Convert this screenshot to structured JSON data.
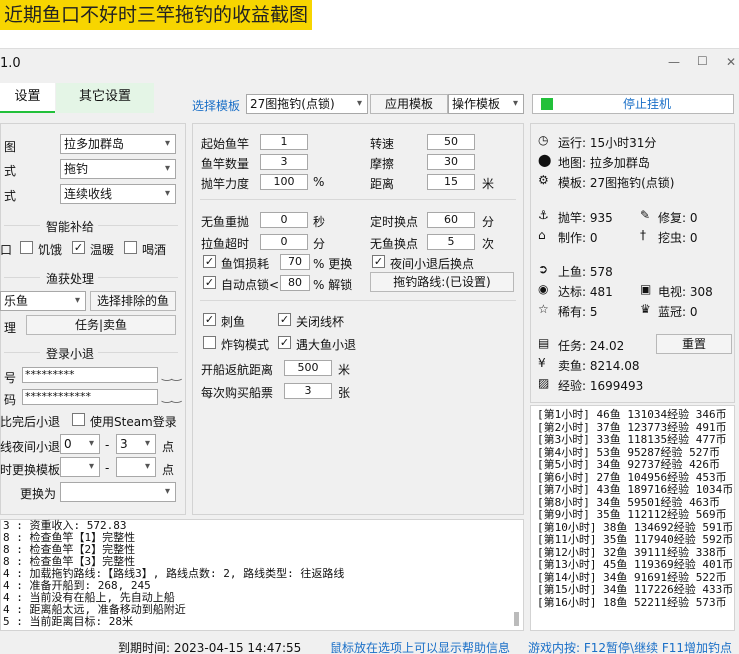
{
  "banner": "近期鱼口不好时三竿拖钓的收益截图",
  "window": {
    "title": "1.0",
    "min": "—",
    "max": "☐",
    "close": "✕"
  },
  "tabs": {
    "tab1": "设置",
    "tab2": "其它设置"
  },
  "toolbar": {
    "template_label": "选择模板",
    "template_value": "27图拖钓(点锁)",
    "apply": "应用模板",
    "operate": "操作模板",
    "stop": "停止挂机"
  },
  "left": {
    "map_label": "图",
    "map_value": "拉多加群岛",
    "mode_label": "式",
    "mode_value": "拖钓",
    "mode2_label": "式",
    "mode2_value": "连续收线",
    "supply_title": "智能补给",
    "supply": [
      "口",
      "饥饿",
      "温暖",
      "喝酒"
    ],
    "catch_title": "渔获处理",
    "catch_sel": "乐鱼",
    "exclude_btn": "选择排除的鱼",
    "manage_label": "理",
    "task_btn": "任务|卖鱼",
    "login_title": "登录小退",
    "acct_label": "号",
    "acct_value": "*********",
    "pwd_label": "码",
    "pwd_value": "************",
    "quit_label": "比完后小退",
    "steam_label": "使用Steam登录",
    "night_label": "线夜间小退",
    "night_from": "0",
    "night_to": "3",
    "night_unit": "点",
    "tmpl_label": "时更换模板",
    "tmpl_unit": "点",
    "dash": "-",
    "change_label": "更换为"
  },
  "mid": {
    "rod_start": "起始鱼竿",
    "rod_start_v": "1",
    "rod_count": "鱼竿数量",
    "rod_count_v": "3",
    "cast_force": "抛竿力度",
    "cast_force_v": "100",
    "pct": "%",
    "speed": "转速",
    "speed_v": "50",
    "friction": "摩擦",
    "friction_v": "30",
    "distance": "距离",
    "distance_v": "15",
    "meter": "米",
    "recast": "无鱼重抛",
    "recast_v": "0",
    "sec": "秒",
    "pull_timeout": "拉鱼超时",
    "pull_timeout_v": "0",
    "min": "分",
    "bait": "鱼饵损耗",
    "bait_v": "70",
    "bait_unit": "% 更换",
    "autolock": "自动点锁<",
    "autolock_v": "80",
    "autolock_unit": "% 解锁",
    "timed": "定时换点",
    "timed_v": "60",
    "timed_unit": "分",
    "nofish": "无鱼换点",
    "nofish_v": "5",
    "nofish_unit": "次",
    "night_switch": "夜间小退后换点",
    "route_btn": "拖钓路线:(已设置)",
    "spear": "刺鱼",
    "close_rod": "关闭线杯",
    "bomb": "炸钩模式",
    "bigfish": "遇大鱼小退",
    "return": "开船返航距离",
    "return_v": "500",
    "return_unit": "米",
    "ticket": "每次购买船票",
    "ticket_v": "3",
    "ticket_unit": "张"
  },
  "stats": {
    "run": "运行: 15小时31分",
    "map": "地图: 拉多加群岛",
    "tmpl": "模板: 27图拖钓(点锁)",
    "cast": "抛竿: 935",
    "repair": "修复: 0",
    "make": "制作: 0",
    "dig": "挖虫: 0",
    "onhook": "上鱼: 578",
    "target": "达标: 481",
    "tv": "电视: 308",
    "rare": "稀有: 5",
    "blue": "蓝冠: 0",
    "task": "任务: 24.02",
    "reset": "重置",
    "sell": "卖鱼: 8214.08",
    "exp": "经验: 1699493"
  },
  "hourly": [
    "[第1小时] 46鱼 131034经验 346币",
    "[第2小时] 37鱼 123773经验 491币",
    "[第3小时] 33鱼 118135经验 477币",
    "[第4小时] 53鱼 95287经验 527币",
    "[第5小时] 34鱼 92737经验 426币",
    "[第6小时] 27鱼 104956经验 453币",
    "[第7小时] 43鱼 189716经验 1034币",
    "[第8小时] 34鱼 59501经验 463币",
    "[第9小时] 35鱼 112112经验 569币",
    "[第10小时] 38鱼 134692经验 591币",
    "[第11小时] 35鱼 117940经验 592币",
    "[第12小时] 32鱼 39111经验 338币",
    "[第13小时] 45鱼 119369经验 401币",
    "[第14小时] 34鱼 91691经验 522币",
    "[第15小时] 34鱼 117226经验 433币",
    "[第16小时] 18鱼 52211经验 573币"
  ],
  "log": [
    "3 : 资重收入: 572.83",
    "8 : 检查鱼竿【1】完整性",
    "8 : 检查鱼竿【2】完整性",
    "8 : 检查鱼竿【3】完整性",
    "4 : 加载拖钓路线:【路线3】, 路线点数: 2, 路线类型: 往返路线",
    "4 : 准备开船到: 268, 245",
    "4 : 当前没有在船上, 先自动上船",
    "4 : 距离船太远, 准备移动到船附近",
    "5 : 当前距离目标: 28米"
  ],
  "status": {
    "expire": "到期时间: 2023-04-15 14:47:55",
    "hint": "鼠标放在选项上可以显示帮助信息",
    "hotkey": "游戏内按: F12暂停\\继续 F11增加钓点"
  },
  "colors": {
    "banner": "#f7d500",
    "link": "#1a6fc7",
    "green": "#22c03a"
  }
}
